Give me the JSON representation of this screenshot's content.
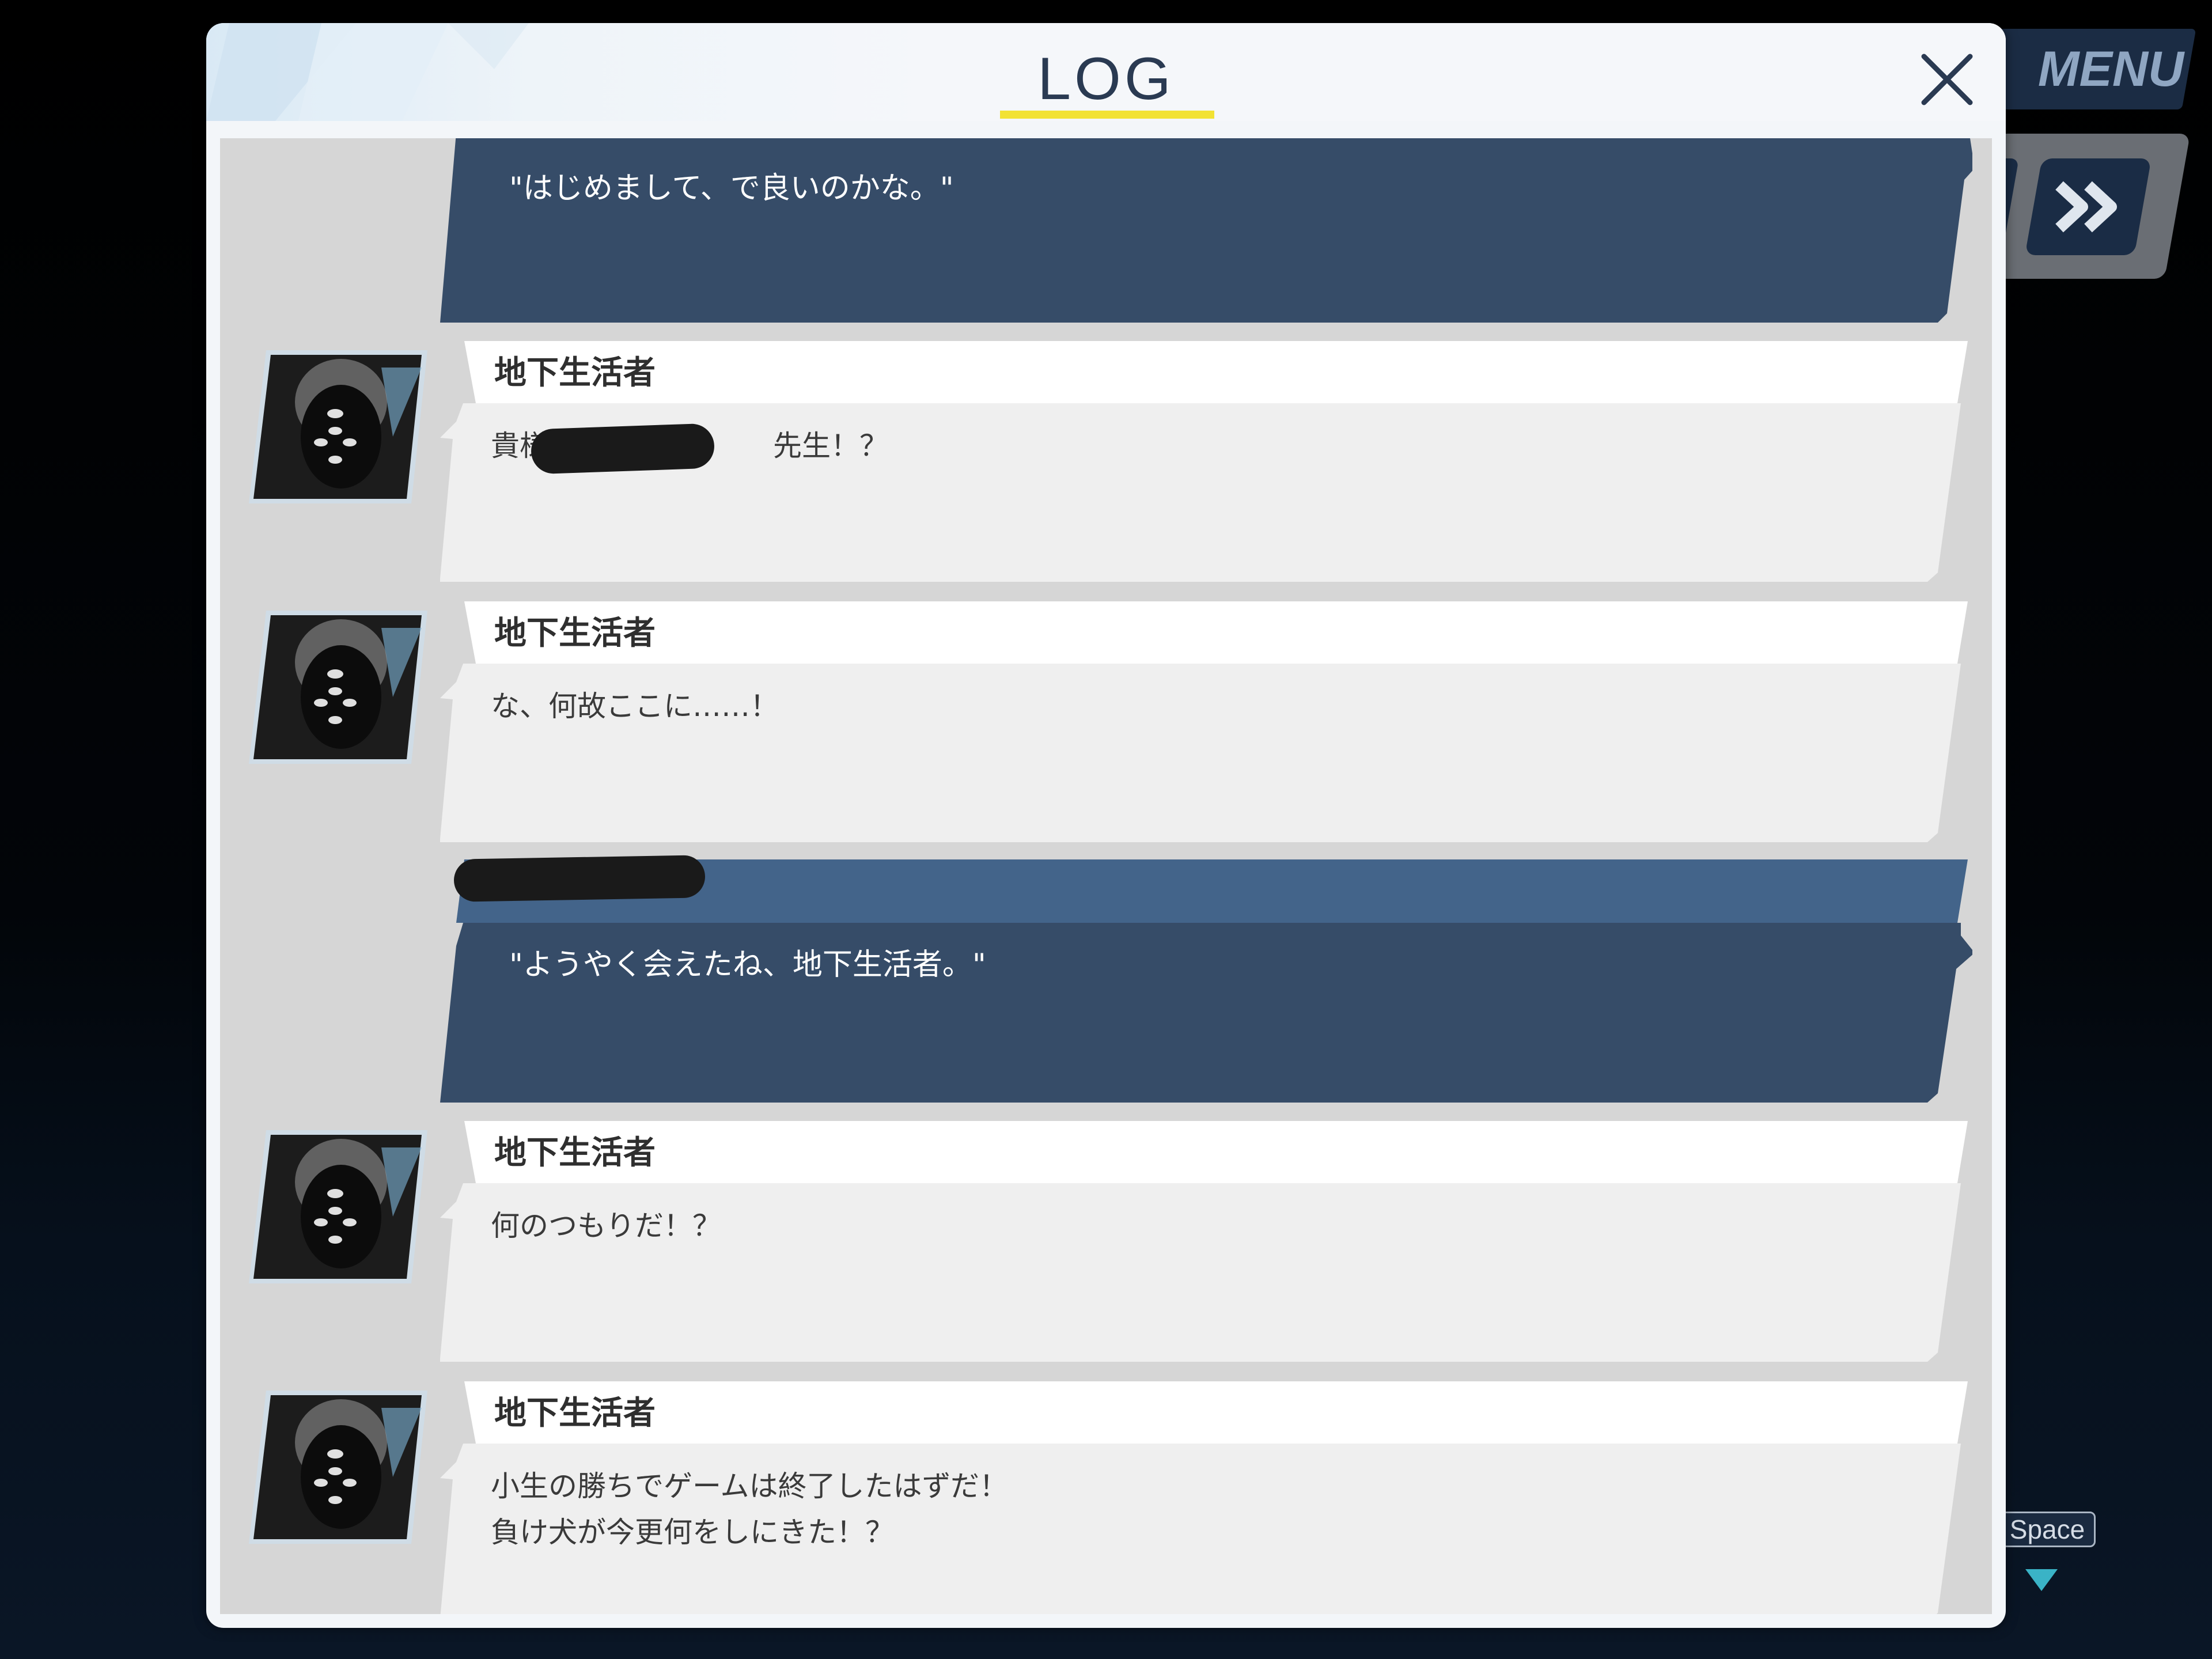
{
  "hud": {
    "menu_label": "MENU",
    "space_label": "Space"
  },
  "log": {
    "title": "LOG",
    "colors": {
      "accent": "#f2e233",
      "player_bubble": "#364c68",
      "npc_bubble": "#efefef",
      "name_band": "#ffffff"
    },
    "entries": [
      {
        "type": "player",
        "text": "\"はじめまして、で良いのかな。\""
      },
      {
        "type": "npc",
        "name": "地下生活者",
        "text_before": "貴様は、",
        "text_after": "先生！？",
        "redacted": true
      },
      {
        "type": "npc",
        "name": "地下生活者",
        "text": "な、何故ここに……！"
      },
      {
        "type": "player",
        "name_redacted": true,
        "text": "\"ようやく会えたね、地下生活者。\""
      },
      {
        "type": "npc",
        "name": "地下生活者",
        "text": "何のつもりだ！？"
      },
      {
        "type": "npc",
        "name": "地下生活者",
        "text": "小生の勝ちでゲームは終了したはずだ！\n負け犬が今更何をしにきた！？"
      }
    ]
  }
}
